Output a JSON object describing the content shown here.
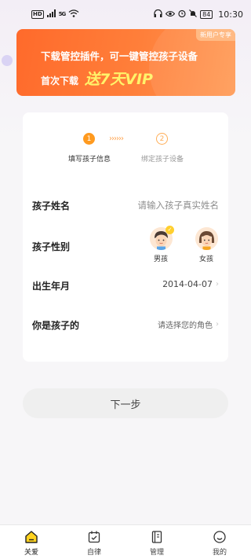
{
  "status_bar": {
    "hd": "HD",
    "network": "5G",
    "battery": "84",
    "time": "10:30"
  },
  "promo": {
    "tag": "新用户专享",
    "line1": "下载管控插件，可一键管控孩子设备",
    "line2_prefix": "首次下载",
    "line2_highlight": "送7天VIP"
  },
  "steps": [
    {
      "number": "1",
      "label": "填写孩子信息",
      "active": true
    },
    {
      "number": "2",
      "label": "绑定孩子设备",
      "active": false
    }
  ],
  "step_arrows": "››››››",
  "form": {
    "name_label": "孩子姓名",
    "name_placeholder": "请输入孩子真实姓名",
    "gender_label": "孩子性别",
    "gender_boy": "男孩",
    "gender_girl": "女孩",
    "gender_selected": "boy",
    "birth_label": "出生年月",
    "birth_value": "2014-04-07",
    "role_label": "你是孩子的",
    "role_placeholder": "请选择您的角色"
  },
  "next_button": "下一步",
  "nav": [
    {
      "label": "关爱",
      "icon": "home-icon",
      "active": true
    },
    {
      "label": "自律",
      "icon": "calendar-icon",
      "active": false
    },
    {
      "label": "管理",
      "icon": "notebook-icon",
      "active": false
    },
    {
      "label": "我的",
      "icon": "profile-smile-icon",
      "active": false
    }
  ],
  "colors": {
    "accent": "#ff9a1f",
    "promo_start": "#ff6a2b",
    "promo_highlight": "#fff36a",
    "active_nav": "#ffd21f"
  }
}
